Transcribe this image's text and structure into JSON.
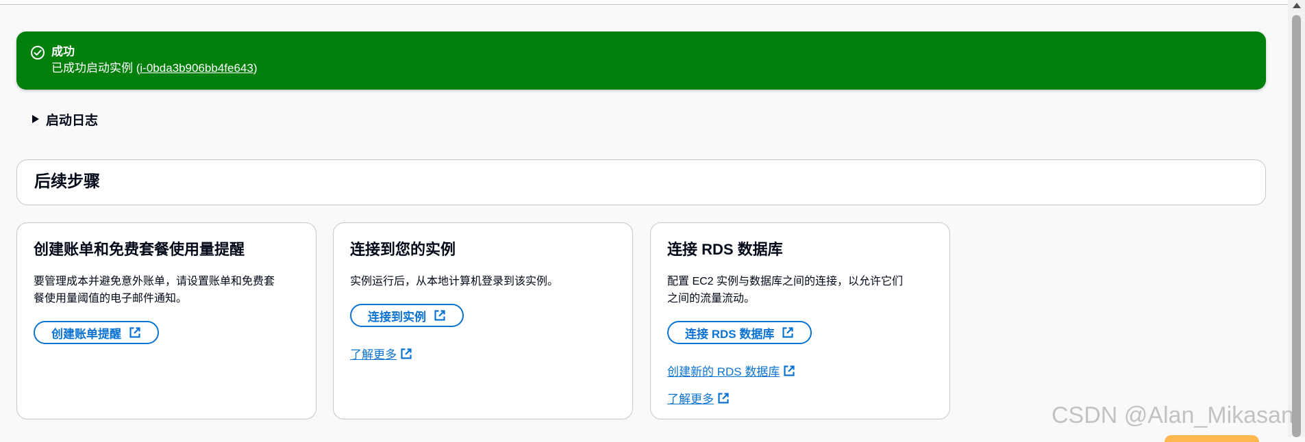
{
  "flash": {
    "title": "成功",
    "message_prefix": "已成功启动实例 (",
    "instance_id": "i-0bda3b906bb4fe643",
    "message_suffix": ")",
    "icon": "check-circle-icon",
    "bg_color": "#037f0c"
  },
  "launch_log": {
    "label": "启动日志"
  },
  "next_steps": {
    "title": "后续步骤"
  },
  "cards": [
    {
      "title": "创建账单和免费套餐使用量提醒",
      "desc_line1": "要管理成本并避免意外账单，请设置账单和免费套",
      "desc_line2": "餐使用量阈值的电子邮件通知。",
      "button": "创建账单提醒"
    },
    {
      "title": "连接到您的实例",
      "desc_line1": "实例运行后，从本地计算机登录到该实例。",
      "button": "连接到实例",
      "link1": "了解更多"
    },
    {
      "title": "连接 RDS 数据库",
      "desc_line1": "配置 EC2 实例与数据库之间的连接，以允许它们",
      "desc_line2": "之间的流量流动。",
      "button": "连接 RDS 数据库",
      "link1": "创建新的 RDS 数据库",
      "link2": "了解更多"
    }
  ],
  "watermark": "CSDN @Alan_Mikasan",
  "colors": {
    "primary_link": "#0972d3",
    "border": "#c6c6cd",
    "text": "#000716"
  }
}
